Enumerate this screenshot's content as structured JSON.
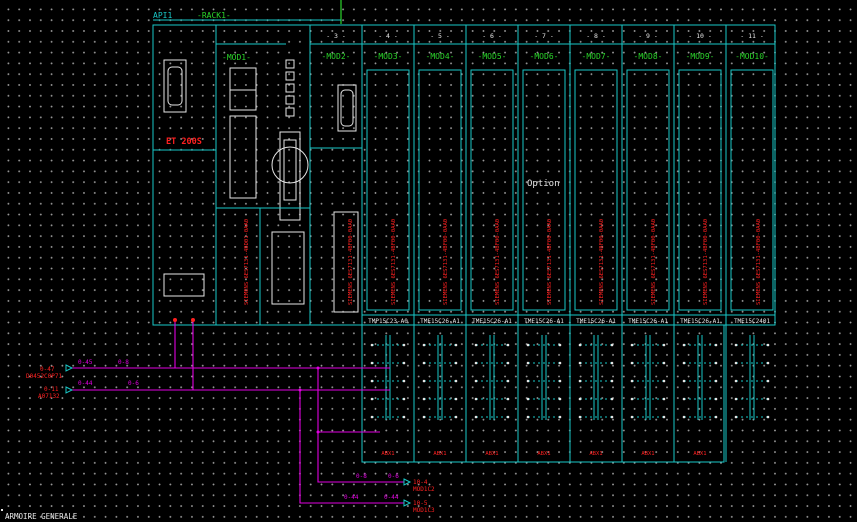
{
  "colors": {
    "frame": "#19c7c7",
    "wire": "#e000e0",
    "label": "#ff2020",
    "green": "#2bd42b",
    "text": "#e6e6e6"
  },
  "header": {
    "api": "API1",
    "rack": "-RACK1-"
  },
  "head_module": {
    "name": "ET 200S",
    "mod1": "-MOD1-"
  },
  "slots": [
    "3",
    "4",
    "5",
    "6",
    "7",
    "8",
    "9",
    "10",
    "11"
  ],
  "modules": [
    "-MOD2-",
    "-MOD3-",
    "-MOD4-",
    "-MOD5-",
    "-MOD6-",
    "-MOD7-",
    "-MOD8-",
    "-MOD9-",
    "-MOD10-"
  ],
  "vertical_labels": [
    "SIEMENS 6ES7131-4BD01-0AA0",
    "SIEMENS 6ES7131-4BF00-0AA0",
    "SIEMENS 6ES7131-4BF00-0AA0",
    "SIEMENS 6ES7131-4BF00-0AA0",
    "SIEMENS 6ES7131-4BF00-0AA0",
    "SIEMENS 6ES7131-4BF00-0AA0",
    "SIEMENS 6ES7131-4BF00-0AA0",
    "SIEMENS 6ES7131-4BF00-0AA0",
    "SIEMENS 6ES7131-4BF00-0AA0",
    "SIEMENS 6ES7131-4BF00-0AA0"
  ],
  "terminals": [
    "TMP15C23-A0",
    "TME15C26-A1",
    "TME15C26-A1",
    "TME15C26-A1",
    "TME15C26-A1",
    "TME15C26-A1",
    "TME15C26-A1",
    "TME15C2401"
  ],
  "option_label": "Option",
  "abx": "ABX1",
  "left_refs": [
    {
      "wire_left": "0-45",
      "wire_right": "0-8",
      "ref1": "0-47",
      "ref2": "D0452C0P71"
    },
    {
      "wire_left": "0-44",
      "wire_right": "0-6",
      "ref1": "0-11",
      "ref2": "A07132"
    }
  ],
  "bottom_refs": [
    {
      "wire_left": "0-8",
      "wire_right": "0-6",
      "ref1": "10-4",
      "ref2": "MOD1C2"
    },
    {
      "wire_left": "0-44",
      "wire_right": "0-44",
      "ref1": "10-5",
      "ref2": "MOD1C3"
    }
  ],
  "footer": "ARMOIRE GENERALE"
}
